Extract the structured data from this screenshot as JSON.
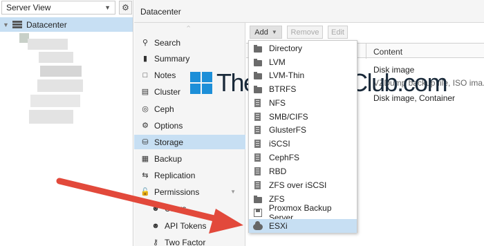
{
  "tree": {
    "view_select": "Server View",
    "root_label": "Datacenter"
  },
  "header": {
    "title": "Datacenter"
  },
  "nav": {
    "items": [
      {
        "label": "Search",
        "icon": "search-icon"
      },
      {
        "label": "Summary",
        "icon": "book-icon"
      },
      {
        "label": "Notes",
        "icon": "note-icon"
      },
      {
        "label": "Cluster",
        "icon": "server-icon"
      },
      {
        "label": "Ceph",
        "icon": "ceph-icon"
      },
      {
        "label": "Options",
        "icon": "gear-icon"
      },
      {
        "label": "Storage",
        "icon": "database-icon"
      },
      {
        "label": "Backup",
        "icon": "floppy-icon"
      },
      {
        "label": "Replication",
        "icon": "retweet-icon"
      },
      {
        "label": "Permissions",
        "icon": "unlock-icon"
      },
      {
        "label": "Users",
        "icon": "user-icon"
      },
      {
        "label": "API Tokens",
        "icon": "user-icon"
      },
      {
        "label": "Two Factor",
        "icon": "key-icon"
      }
    ],
    "active": "Storage"
  },
  "toolbar": {
    "add_label": "Add",
    "remove_label": "Remove",
    "edit_label": "Edit"
  },
  "grid": {
    "content_header": "Content",
    "rows": [
      "Disk image",
      "VZDump backup file, ISO ima...",
      "Disk image, Container"
    ]
  },
  "add_menu": {
    "items": [
      {
        "label": "Directory",
        "icon": "folder-icon"
      },
      {
        "label": "LVM",
        "icon": "folder-icon"
      },
      {
        "label": "LVM-Thin",
        "icon": "folder-icon"
      },
      {
        "label": "BTRFS",
        "icon": "folder-icon"
      },
      {
        "label": "NFS",
        "icon": "server-icon"
      },
      {
        "label": "SMB/CIFS",
        "icon": "server-icon"
      },
      {
        "label": "GlusterFS",
        "icon": "server-icon"
      },
      {
        "label": "iSCSI",
        "icon": "server-icon"
      },
      {
        "label": "CephFS",
        "icon": "server-icon"
      },
      {
        "label": "RBD",
        "icon": "server-icon"
      },
      {
        "label": "ZFS over iSCSI",
        "icon": "server-icon"
      },
      {
        "label": "ZFS",
        "icon": "folder-icon"
      },
      {
        "label": "Proxmox Backup Server",
        "icon": "floppy-icon"
      },
      {
        "label": "ESXi",
        "icon": "cloud-icon"
      }
    ],
    "highlighted": "ESXi"
  },
  "watermark": {
    "text": "TheWindowsClub.com"
  },
  "colors": {
    "selection": "#c7dff3",
    "arrow": "#e2493b",
    "panel_bg": "#f5f5f5"
  }
}
